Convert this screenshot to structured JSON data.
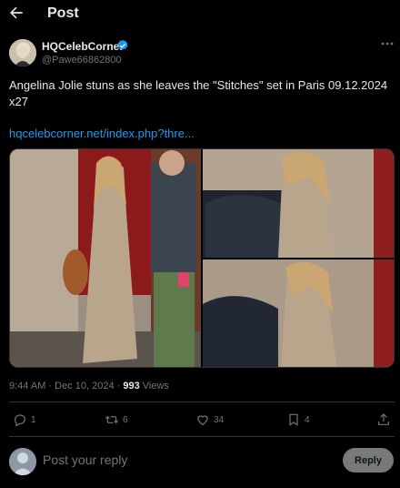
{
  "header": {
    "title": "Post"
  },
  "author": {
    "name": "HQCelebCorner",
    "handle": "@Pawe66862800"
  },
  "tweet": {
    "text": "Angelina Jolie stuns as she leaves the \"Stitches\" set in Paris 09.12.2024 x27",
    "link": "hqcelebcorner.net/index.php?thre..."
  },
  "meta": {
    "time": "9:44 AM · Dec 10, 2024 · ",
    "views_count": "993",
    "views_label": " Views"
  },
  "actions": {
    "replies": "1",
    "retweets": "6",
    "likes": "34",
    "bookmarks": "4"
  },
  "reply": {
    "placeholder": "Post your reply",
    "button_label": "Reply"
  },
  "colors": {
    "accent": "#1d9bf0",
    "background": "#000000",
    "muted": "#71767b",
    "verified": "#1d9bf0"
  },
  "icons": [
    "back-arrow-icon",
    "verified-badge-icon",
    "more-icon",
    "reply-icon",
    "retweet-icon",
    "like-icon",
    "bookmark-icon",
    "share-icon"
  ]
}
